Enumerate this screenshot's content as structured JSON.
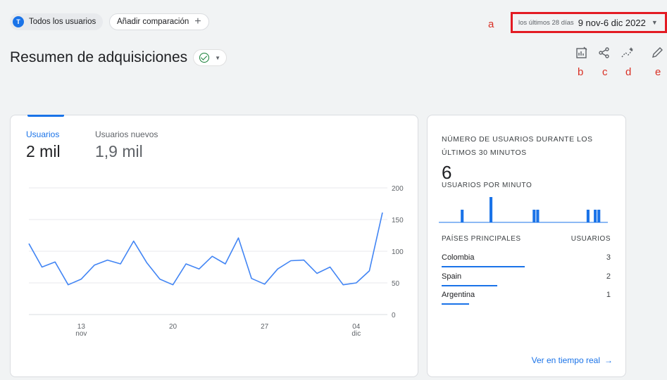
{
  "topbar": {
    "segment": {
      "avatar_letter": "T",
      "label": "Todos los usuarios"
    },
    "compare": {
      "label": "Añadir comparación",
      "plus": "+"
    },
    "date": {
      "preset": "los últimos 28 días",
      "range": "9 nov-6 dic 2022",
      "caret": "▼"
    }
  },
  "annotations": {
    "a": "a",
    "b": "b",
    "c": "c",
    "d": "d",
    "e": "e"
  },
  "page": {
    "title": "Resumen de adquisiciones",
    "caret": "▼"
  },
  "toolbar_icons": [
    "customize-report-icon",
    "share-icon",
    "insights-icon",
    "edit-icon"
  ],
  "main_card": {
    "metrics": [
      {
        "label": "Usuarios",
        "value": "2 mil"
      },
      {
        "label": "Usuarios nuevos",
        "value": "1,9 mil"
      }
    ]
  },
  "chart_data": {
    "type": "line",
    "x_ticks": [
      {
        "day": 13,
        "label": "13",
        "sub": "nov"
      },
      {
        "day": 20,
        "label": "20",
        "sub": ""
      },
      {
        "day": 27,
        "label": "27",
        "sub": ""
      },
      {
        "day": 34,
        "label": "04",
        "sub": "dic"
      }
    ],
    "y_ticks": [
      0,
      50,
      100,
      150,
      200
    ],
    "ylim": [
      0,
      200
    ],
    "series": [
      {
        "color": "#4285f4",
        "points": [
          [
            9,
            112
          ],
          [
            10,
            75
          ],
          [
            11,
            83
          ],
          [
            12,
            47
          ],
          [
            13,
            56
          ],
          [
            14,
            78
          ],
          [
            15,
            86
          ],
          [
            16,
            80
          ],
          [
            17,
            116
          ],
          [
            18,
            82
          ],
          [
            19,
            56
          ],
          [
            20,
            47
          ],
          [
            21,
            80
          ],
          [
            22,
            72
          ],
          [
            23,
            92
          ],
          [
            24,
            80
          ],
          [
            25,
            121
          ],
          [
            26,
            57
          ],
          [
            27,
            48
          ],
          [
            28,
            72
          ],
          [
            29,
            85
          ],
          [
            30,
            86
          ],
          [
            31,
            65
          ],
          [
            32,
            75
          ],
          [
            33,
            47
          ],
          [
            34,
            50
          ],
          [
            35,
            69
          ],
          [
            36,
            161
          ]
        ]
      }
    ]
  },
  "realtime": {
    "title": "NÚMERO DE USUARIOS DURANTE LOS ÚLTIMOS 30 MINUTOS",
    "value": "6",
    "subtitle": "USUARIOS POR MINUTO",
    "per_minute": [
      0,
      0,
      0,
      0,
      0,
      0,
      1,
      0,
      0,
      0,
      0,
      0,
      0,
      0,
      2,
      0,
      0,
      0,
      0,
      0,
      0,
      0,
      0,
      0,
      0,
      0,
      1,
      1,
      0,
      0,
      0,
      0,
      0,
      0,
      0,
      0,
      0,
      0,
      0,
      0,
      0,
      1,
      0,
      1,
      1,
      0,
      0
    ],
    "bar_color": "#1a73e8",
    "headers": {
      "country": "PAÍSES PRINCIPALES",
      "users": "USUARIOS"
    },
    "countries": [
      {
        "name": "Colombia",
        "users": "3",
        "share": 1.0
      },
      {
        "name": "Spain",
        "users": "2",
        "share": 0.667
      },
      {
        "name": "Argentina",
        "users": "1",
        "share": 0.333
      }
    ],
    "link": "Ver en tiempo real",
    "link_arrow": "→"
  }
}
